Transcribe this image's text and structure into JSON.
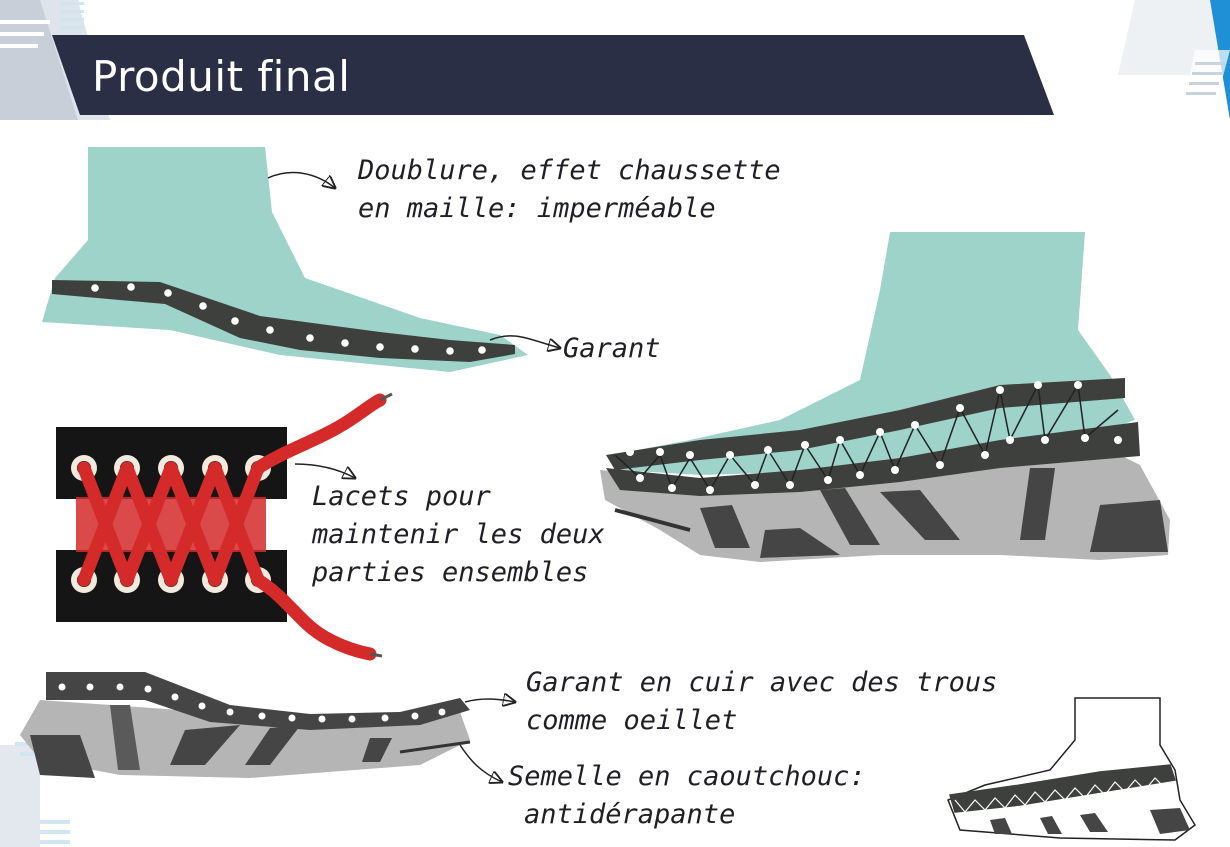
{
  "header": {
    "title": "Produit final"
  },
  "annotations": {
    "doublure": {
      "line1": "Doublure, effet chaussette",
      "line2": "en maille: imperméable"
    },
    "garant": {
      "line1": "Garant"
    },
    "lacets": {
      "line1": "Lacets pour",
      "line2": "maintenir les deux",
      "line3": "parties ensembles"
    },
    "garant_cuir": {
      "line1": "Garant en cuir avec des trous",
      "line2": "comme oeillet"
    },
    "semelle": {
      "line1": "Semelle en caoutchouc:",
      "line2": "antidérapante"
    }
  },
  "colors": {
    "banner": "#2b2f45",
    "sock": "#9dd3c9",
    "welt": "#3e403d",
    "sole": "#b5b5b5",
    "sole_dark": "#454545",
    "lace": "#d42a2a",
    "lace_panel": "#151515",
    "eyelet": "#f2eadc"
  }
}
